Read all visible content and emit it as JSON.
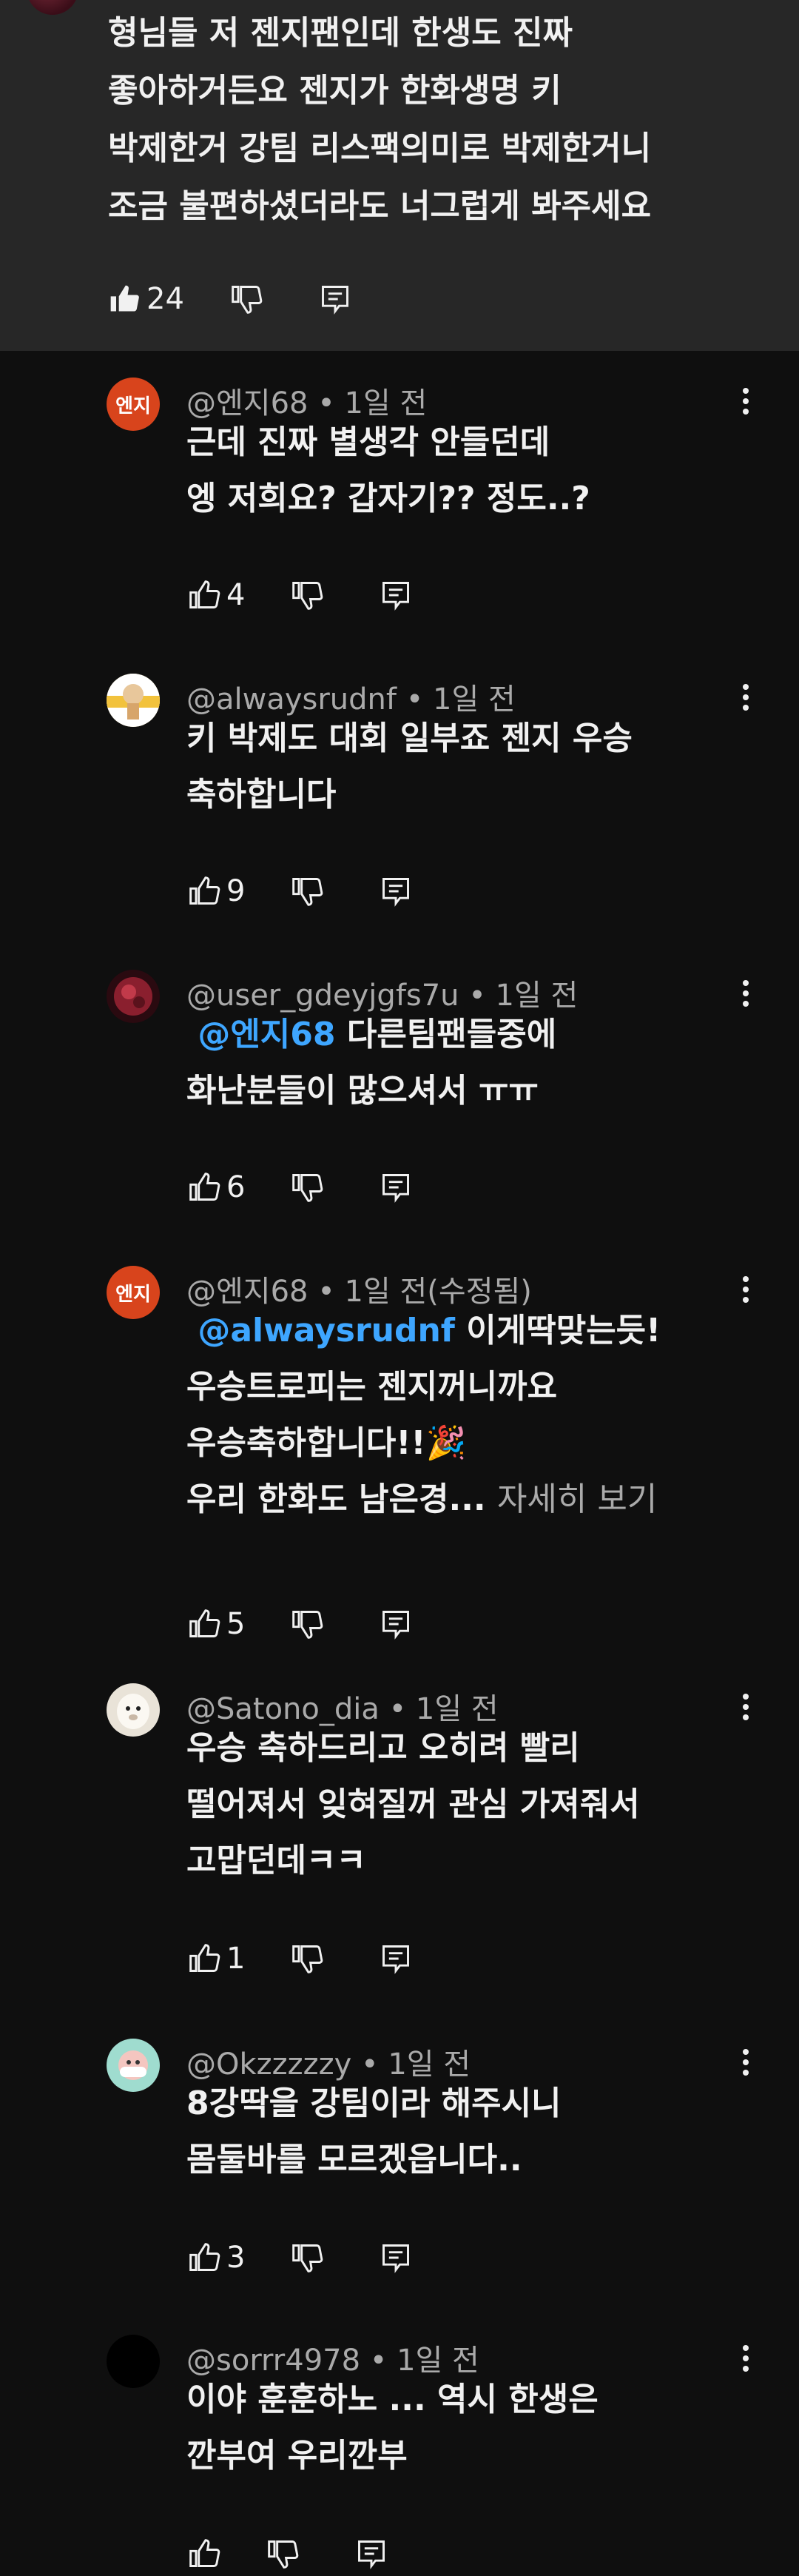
{
  "parent": {
    "lines": [
      "형님들 저 젠지팬인데 한생도 진짜",
      "좋아하거든요 젠지가 한화생명 키",
      "박제한거 강팀 리스팩의미로 박제한거니",
      "조금 불편하셨더라도 너그럽게 봐주세요"
    ],
    "likes": "24"
  },
  "replies": [
    {
      "avatar_text": "엔지",
      "avatar_color": "#d8441c",
      "meta": "@엔지68 • 1일 전",
      "lines": [
        "근데 진짜 별생각 안들던데",
        "엥 저희요? 갑자기?? 정도..?"
      ],
      "likes": "4"
    },
    {
      "avatar_text": "",
      "avatar_color": "#f4d06b",
      "meta": "@alwaysrudnf • 1일 전",
      "lines": [
        "키 박제도 대회 일부죠 젠지 우승",
        "축하합니다"
      ],
      "likes": "9"
    },
    {
      "avatar_text": "",
      "avatar_color": "#7a1f2a",
      "meta": "@user_gdeyjgfs7u • 1일 전",
      "mention": "@엔지68",
      "lines": [
        "다른팀팬들중에",
        "화난분들이 많으셔서 ㅠㅠ"
      ],
      "likes": "6"
    },
    {
      "avatar_text": "엔지",
      "avatar_color": "#d8441c",
      "meta": "@엔지68 • 1일 전(수정됨)",
      "mention": "@alwaysrudnf",
      "lines": [
        "이게딱맞는듯!",
        "우승트로피는 젠지꺼니까요",
        "우승축하합니다!!🎉",
        "우리 한화도 남은경..."
      ],
      "more": "자세히 보기",
      "likes": "5"
    },
    {
      "avatar_text": "",
      "avatar_color": "#e8e2d8",
      "meta": "@Satono_dia • 1일 전",
      "lines": [
        "우승 축하드리고 오히려 빨리",
        "떨어져서 잊혀질꺼 관심 가져줘서",
        "고맙던데ㅋㅋ"
      ],
      "likes": "1"
    },
    {
      "avatar_text": "",
      "avatar_color": "#8fd3c9",
      "meta": "@Okzzzzzy • 1일 전",
      "lines": [
        "8강딱을 강팀이라 해주시니",
        "몸둘바를 모르겠읍니다.."
      ],
      "likes": "3"
    },
    {
      "avatar_text": "",
      "avatar_color": "#000000",
      "meta": "@sorrr4978 • 1일 전",
      "lines": [
        "이야 훈훈하노 ... 역시 한생은",
        "깐부여 우리깐부"
      ],
      "likes": ""
    }
  ],
  "icons": {
    "like": "thumbs-up-icon",
    "dislike": "thumbs-down-icon",
    "reply": "reply-comment-icon",
    "menu": "more-vertical-icon"
  }
}
